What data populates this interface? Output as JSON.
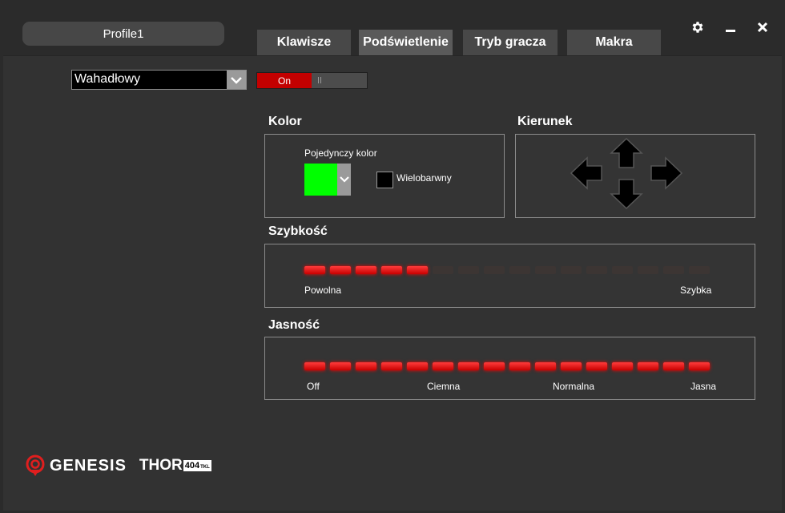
{
  "profile": {
    "name": "Profile1"
  },
  "tabs": [
    {
      "label": "Klawisze",
      "active": false
    },
    {
      "label": "Podświetlenie",
      "active": true
    },
    {
      "label": "Tryb gracza",
      "active": false
    },
    {
      "label": "Makra",
      "active": false
    }
  ],
  "window_controls": {
    "settings_icon": "gear-icon",
    "minimize_icon": "minimize-icon",
    "close_icon": "close-icon"
  },
  "effect_select": {
    "value": "Wahadłowy"
  },
  "power_toggle": {
    "label": "On",
    "state": "on"
  },
  "kolor": {
    "title": "Kolor",
    "single_color_label": "Pojedynczy kolor",
    "single_color_value": "#00ff00",
    "multicolor_label": "Wielobarwny",
    "multicolor_checked": false
  },
  "kierunek": {
    "title": "Kierunek",
    "arrows": [
      "left-arrow-icon",
      "up-arrow-icon",
      "down-arrow-icon",
      "right-arrow-icon"
    ]
  },
  "szybkosc": {
    "title": "Szybkość",
    "segments_total": 16,
    "segments_active": 5,
    "min_label": "Powolna",
    "max_label": "Szybka"
  },
  "jasnosc": {
    "title": "Jasność",
    "segments_total": 16,
    "segments_active": 16,
    "labels": [
      "Off",
      "Ciemna",
      "Normalna",
      "Jasna"
    ]
  },
  "brand": {
    "name": "GENESIS",
    "product": "THOR",
    "model": "404",
    "model_suffix": "TKL"
  },
  "colors": {
    "accent": "#c30000",
    "led_on": "#ff1a1a",
    "led_off": "#3c3533",
    "swatch": "#00ff00"
  }
}
